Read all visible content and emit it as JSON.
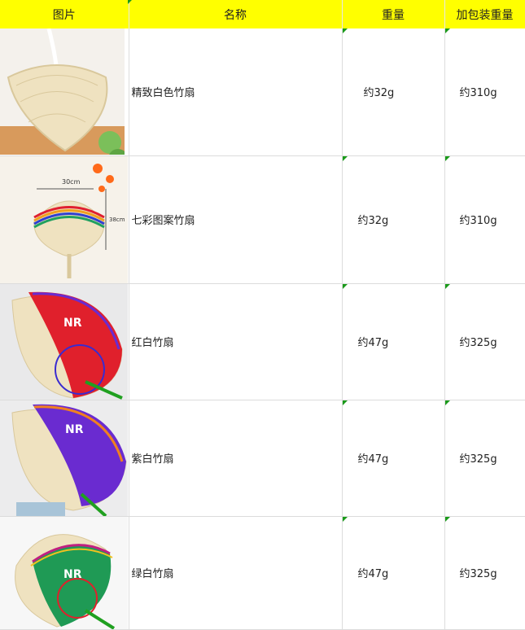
{
  "header": {
    "col_image": "图片",
    "col_name": "名称",
    "col_weight": "重量",
    "col_packed_weight": "加包装重量"
  },
  "rows": [
    {
      "name": "精致白色竹扇",
      "weight": "约32g",
      "packed_weight": "约310g",
      "image_icon": "white-bamboo-fan"
    },
    {
      "name": "七彩图案竹扇",
      "weight": "约32g",
      "packed_weight": "约310g",
      "image_icon": "rainbow-bamboo-fan",
      "image_labels": {
        "width": "30cm",
        "height": "38cm"
      }
    },
    {
      "name": "红白竹扇",
      "weight": "约47g",
      "packed_weight": "约325g",
      "image_icon": "red-white-bamboo-fan",
      "image_logo": "NR"
    },
    {
      "name": "紫白竹扇",
      "weight": "约47g",
      "packed_weight": "约325g",
      "image_icon": "purple-white-bamboo-fan",
      "image_logo": "NR"
    },
    {
      "name": "绿白竹扇",
      "weight": "约47g",
      "packed_weight": "约325g",
      "image_icon": "green-white-bamboo-fan",
      "image_logo": "NR"
    }
  ],
  "colors": {
    "header_bg": "#ffff00",
    "corner_marker": "#1a9a1a",
    "fan_straw": "#efe2c0",
    "red": "#e0202c",
    "purple": "#6a2bd0",
    "green": "#1f9a55"
  }
}
